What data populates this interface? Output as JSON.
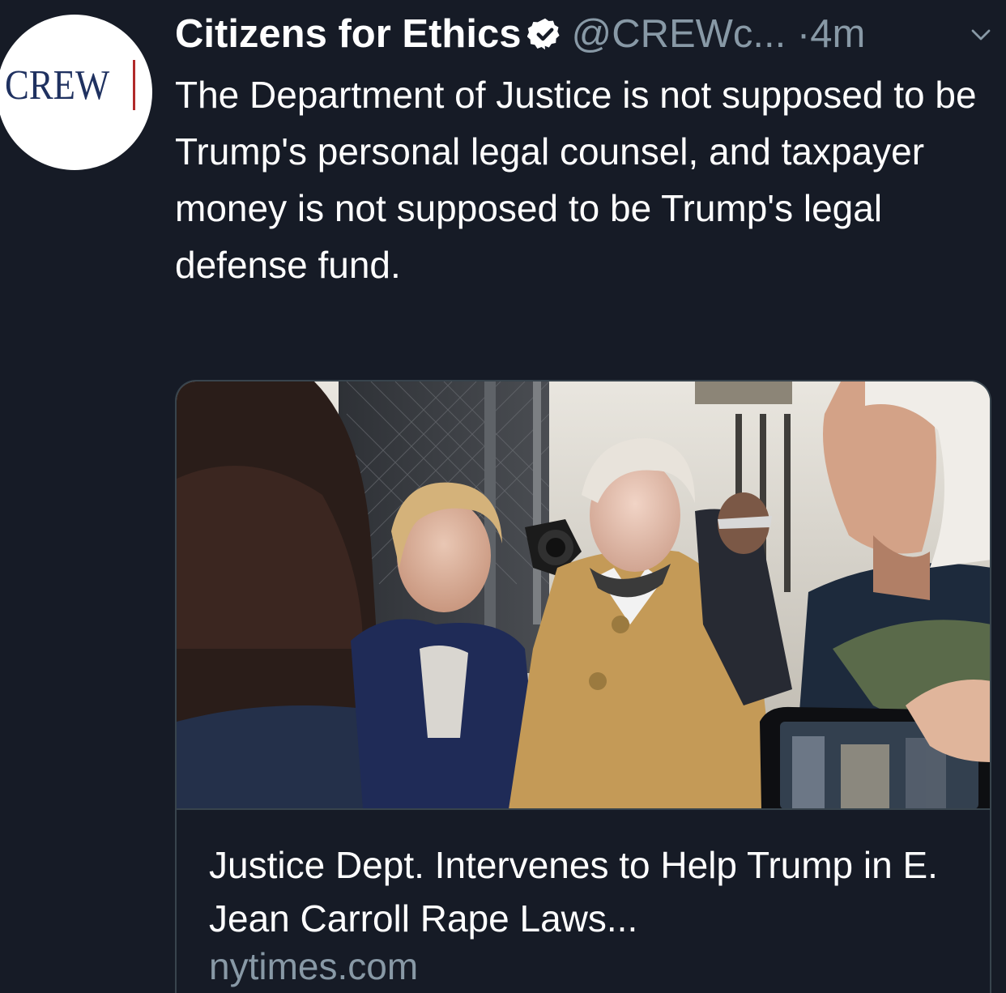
{
  "tweet": {
    "author_name": "Citizens for Ethics",
    "author_handle": "@CREWc...",
    "separator": "·",
    "timestamp": "4m",
    "avatar_logo_text": "CREW",
    "body": "The Department of Justice is not supposed to be Trump's personal legal counsel, and taxpayer money is not supposed to be Trump's legal defense fund."
  },
  "link_card": {
    "title": "Justice Dept. Intervenes to Help Trump in E. Jean Carroll Rape Laws...",
    "domain": "nytimes.com",
    "image": "news-photo"
  },
  "icons": {
    "verified": "verified-badge-icon",
    "menu": "chevron-down-icon"
  },
  "colors": {
    "background": "#161b26",
    "secondary_text": "#8899a6",
    "card_border": "#38444d",
    "brand_navy": "#1f3160",
    "brand_red": "#b12a2a"
  }
}
